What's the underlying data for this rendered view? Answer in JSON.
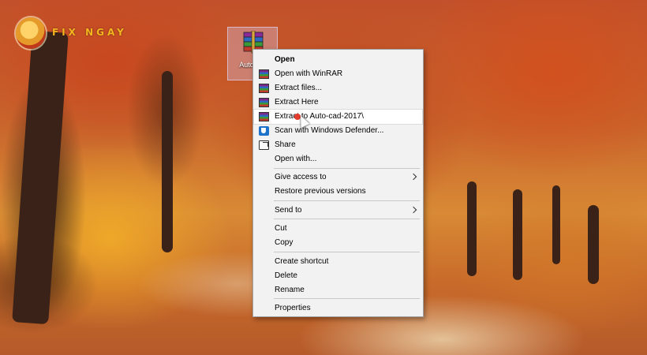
{
  "logo": {
    "text": "FIX NGAY",
    "color": "#f4b51f"
  },
  "desktop": {
    "icon": {
      "label": "Auto-c...",
      "icon": "winrar-archive-icon"
    }
  },
  "context_menu": {
    "items": [
      {
        "label": "Open",
        "bold": true
      },
      {
        "label": "Open with WinRAR",
        "icon": "winrar-icon"
      },
      {
        "label": "Extract files...",
        "icon": "winrar-icon"
      },
      {
        "label": "Extract Here",
        "icon": "winrar-icon"
      },
      {
        "label": "Extract to Auto-cad-2017\\",
        "icon": "winrar-icon",
        "highlighted": true
      },
      {
        "label": "Scan with Windows Defender...",
        "icon": "windows-defender-icon"
      },
      {
        "label": "Share",
        "icon": "share-icon"
      },
      {
        "label": "Open with..."
      },
      {
        "label": "Give access to",
        "submenu": true
      },
      {
        "label": "Restore previous versions"
      },
      {
        "label": "Send to",
        "submenu": true
      },
      {
        "label": "Cut"
      },
      {
        "label": "Copy"
      },
      {
        "label": "Create shortcut"
      },
      {
        "label": "Delete"
      },
      {
        "label": "Rename"
      },
      {
        "label": "Properties"
      }
    ]
  },
  "colors": {
    "menu_background": "#f2f2f2",
    "menu_border": "#a0a0a0",
    "highlight": "#ffffff",
    "cursor_marker": "#e53b2c"
  }
}
